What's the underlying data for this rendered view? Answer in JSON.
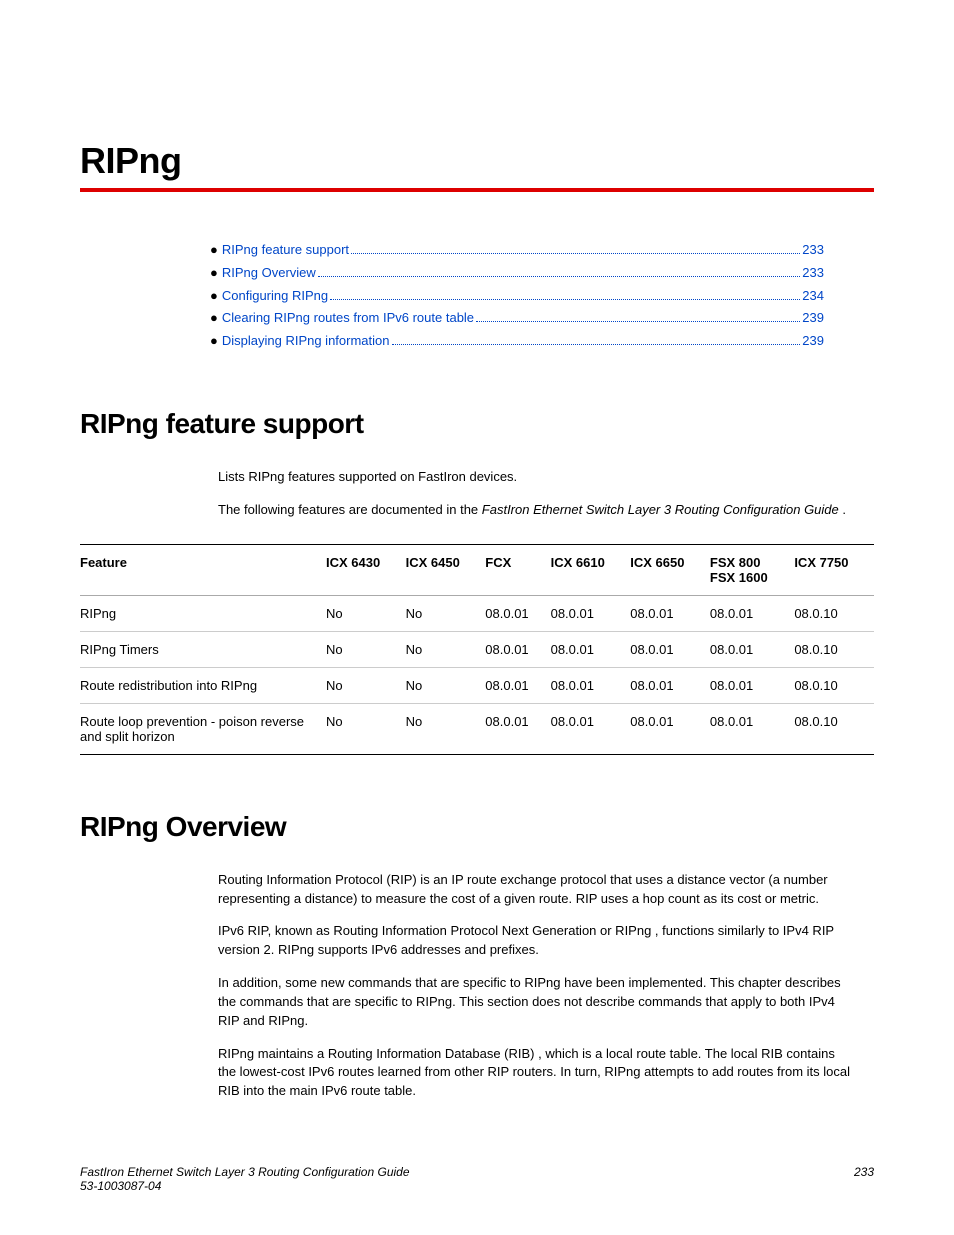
{
  "chapter_title": "RIPng",
  "toc": [
    {
      "label": "RIPng feature support",
      "page": "233"
    },
    {
      "label": "RIPng Overview",
      "page": "233"
    },
    {
      "label": "Configuring RIPng",
      "page": "234"
    },
    {
      "label": "Clearing RIPng routes from IPv6 route table",
      "page": "239"
    },
    {
      "label": "Displaying RIPng information",
      "page": "239"
    }
  ],
  "section1": {
    "title": "RIPng feature support",
    "intro": "Lists RIPng features supported on FastIron devices.",
    "doc_line_prefix": "The following features are documented in the ",
    "doc_line_italic": "FastIron Ethernet Switch Layer 3 Routing Configuration Guide",
    "doc_line_suffix": " ."
  },
  "table": {
    "headers": [
      "Feature",
      "ICX 6430",
      "ICX 6450",
      "FCX",
      "ICX 6610",
      "ICX 6650",
      "FSX 800\nFSX 1600",
      "ICX 7750"
    ],
    "rows": [
      [
        "RIPng",
        "No",
        "No",
        "08.0.01",
        "08.0.01",
        "08.0.01",
        "08.0.01",
        "08.0.10"
      ],
      [
        "RIPng Timers",
        "No",
        "No",
        "08.0.01",
        "08.0.01",
        "08.0.01",
        "08.0.01",
        "08.0.10"
      ],
      [
        "Route redistribution into RIPng",
        "No",
        "No",
        "08.0.01",
        "08.0.01",
        "08.0.01",
        "08.0.01",
        "08.0.10"
      ],
      [
        "Route loop prevention - poison reverse and split horizon",
        "No",
        "No",
        "08.0.01",
        "08.0.01",
        "08.0.01",
        "08.0.01",
        "08.0.10"
      ]
    ]
  },
  "section2": {
    "title": "RIPng Overview",
    "paragraphs": [
      "Routing Information Protocol (RIP) is an IP route exchange protocol that uses a distance vector (a number representing a distance) to measure the cost of a given route. RIP uses a hop count as its cost or metric.",
      "IPv6 RIP, known as Routing Information Protocol Next Generation or RIPng , functions similarly to IPv4 RIP version 2. RIPng supports IPv6 addresses and prefixes.",
      "In addition, some new commands that are specific to RIPng have been implemented. This chapter describes the commands that are specific to RIPng. This section does not describe commands that apply to both IPv4 RIP and RIPng.",
      "RIPng maintains a Routing Information Database (RIB) , which is a local route table. The local RIB contains the lowest-cost IPv6 routes learned from other RIP routers. In turn, RIPng attempts to add routes from its local RIB into the main IPv6 route table."
    ]
  },
  "footer": {
    "left_line1": "FastIron Ethernet Switch Layer 3 Routing Configuration Guide",
    "left_line2": "53-1003087-04",
    "right": "233"
  }
}
